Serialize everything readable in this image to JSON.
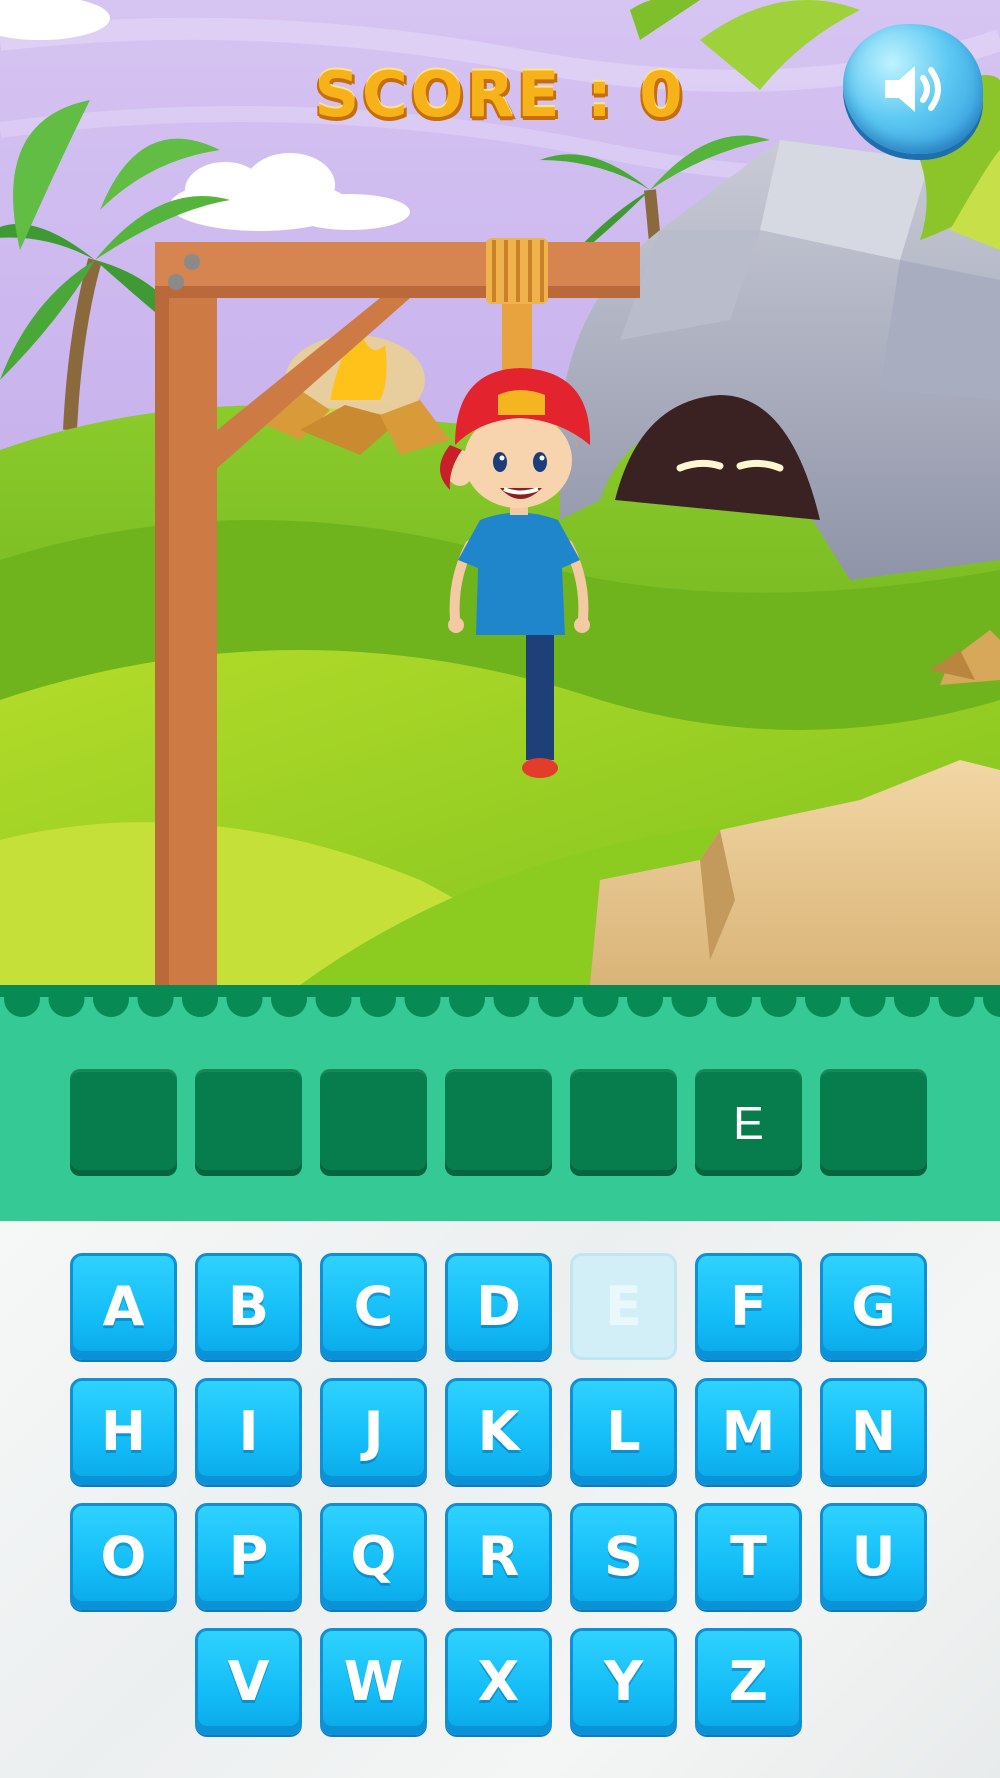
{
  "header": {
    "score_text": "SCORE : 0",
    "sound_icon": "speaker-on-icon"
  },
  "word": {
    "length": 7,
    "slots": [
      "",
      "",
      "",
      "",
      "",
      "E",
      ""
    ]
  },
  "keyboard": {
    "rows": [
      [
        "A",
        "B",
        "C",
        "D",
        "E",
        "F",
        "G"
      ],
      [
        "H",
        "I",
        "J",
        "K",
        "L",
        "M",
        "N"
      ],
      [
        "O",
        "P",
        "Q",
        "R",
        "S",
        "T",
        "U"
      ],
      [
        "V",
        "W",
        "X",
        "Y",
        "Z"
      ]
    ],
    "used_letters": [
      "E"
    ]
  },
  "hangman": {
    "visible_parts": [
      "head",
      "torso",
      "left-arm",
      "right-arm",
      "one-leg"
    ]
  },
  "colors": {
    "slot_bg": "#077c4c",
    "panel_bg": "#35c996",
    "key_bg": "#14bdf7",
    "key_used_bg": "#d2eff8",
    "score": "#f7b21a"
  }
}
